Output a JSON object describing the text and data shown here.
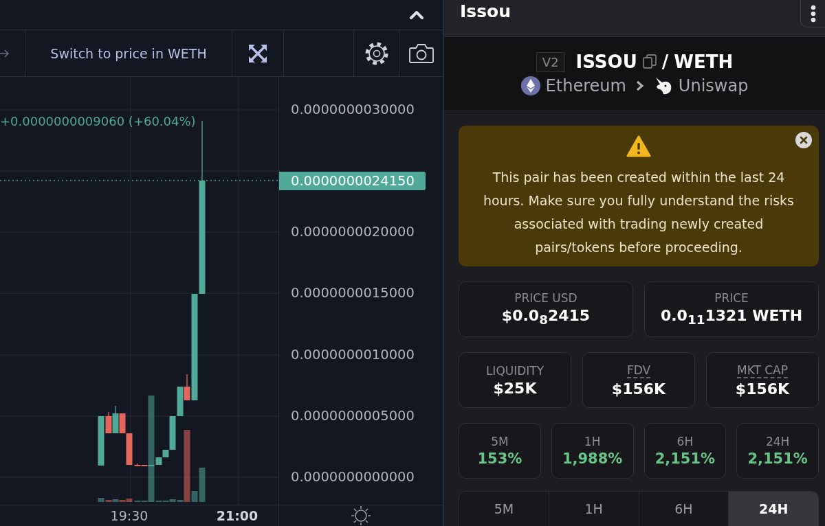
{
  "chart_panel": {
    "switch_label": "Switch to price in WETH",
    "change": "+0.0000000009060 (+60.04%)",
    "price_ticks": [
      "0.0000000030000",
      "0.0000000020000",
      "0.0000000015000",
      "0.0000000010000",
      "0.0000000005000",
      "0.0000000000000"
    ],
    "last_price": "0.0000000024150",
    "time_labels": [
      {
        "label": "19:30",
        "bold": false
      },
      {
        "label": "21:00",
        "bold": true
      }
    ]
  },
  "pair": {
    "name": "Issou",
    "version": "V2",
    "base": "ISSOU",
    "separator": "/",
    "quote": "WETH",
    "chain": "Ethereum",
    "dex": "Uniswap"
  },
  "warning": {
    "text": "This pair has been created within the last 24 hours. Make sure you fully understand the risks associated with trading newly created pairs/tokens before proceeding."
  },
  "price_cards": [
    {
      "label": "PRICE USD",
      "value": "$0.0$_{8}$2415"
    },
    {
      "label": "PRICE",
      "value": "0.0$_{11}$1321 WETH"
    }
  ],
  "stats": [
    {
      "label": "LIQUIDITY",
      "value": "$25K",
      "tooltip": false
    },
    {
      "label": "FDV",
      "value": "$156K",
      "tooltip": true
    },
    {
      "label": "MKT CAP",
      "value": "$156K",
      "tooltip": true
    }
  ],
  "changes": [
    {
      "label": "5M",
      "value": "153%"
    },
    {
      "label": "1H",
      "value": "1,988%"
    },
    {
      "label": "6H",
      "value": "2,151%"
    },
    {
      "label": "24H",
      "value": "2,151%"
    }
  ],
  "tabs": [
    {
      "label": "5M",
      "selected": false
    },
    {
      "label": "1H",
      "selected": false
    },
    {
      "label": "6H",
      "selected": false
    },
    {
      "label": "24H",
      "selected": true
    }
  ]
}
